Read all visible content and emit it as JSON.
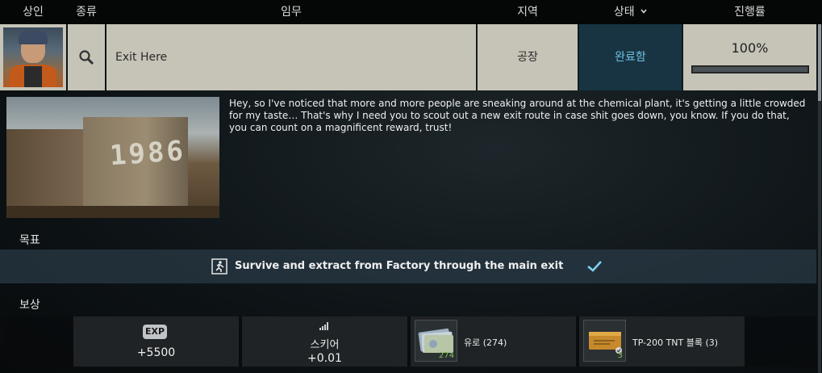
{
  "columns": {
    "trader": "상인",
    "type": "종류",
    "task": "임무",
    "location": "지역",
    "status": "상태",
    "progress": "진행률"
  },
  "icons": {
    "status_sort": "chevron-down-icon",
    "type": "search-icon",
    "objective": "exit-running-man-icon",
    "objective_done": "checkmark-icon",
    "skill": "skill-bars-icon"
  },
  "quest": {
    "name": "Exit Here",
    "location": "공장",
    "status": "완료함",
    "progress_text": "100%",
    "progress_fraction": 1.0
  },
  "quest_image": {
    "sign_text": "1986"
  },
  "description": "Hey, so I've noticed that more and more people are sneaking around at the chemical plant, it's getting a little crowded for my taste… That's why I need you to scout out a new exit route in case shit goes down, you know. If you do that, you can count on a magnificent reward, trust!",
  "objectives": {
    "label": "목표",
    "items": [
      {
        "text": "Survive and extract from Factory through the main exit",
        "completed": true
      }
    ]
  },
  "rewards": {
    "label": "보상",
    "exp": {
      "badge": "EXP",
      "value": "+5500"
    },
    "skill": {
      "name": "스키어",
      "value": "+0.01"
    },
    "items": [
      {
        "name": "유로 (274)",
        "count": "274"
      },
      {
        "name": "TP-200 TNT 블록 (3)",
        "count": "3"
      }
    ]
  },
  "colors": {
    "status_bg": "#183442",
    "status_text": "#6fc0e0",
    "accent_check": "#7fd0f0",
    "item_count": "#86c45a"
  }
}
